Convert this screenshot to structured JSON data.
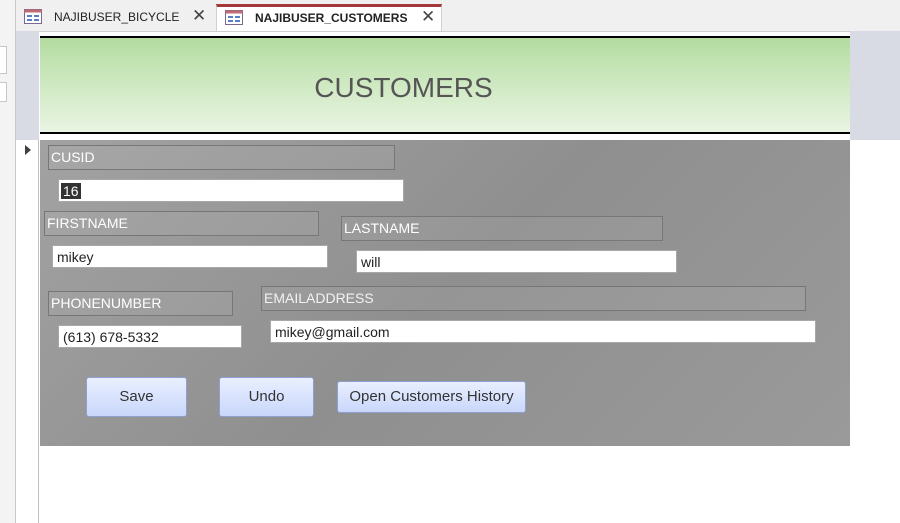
{
  "tabs": [
    {
      "label": "NAJIBUSER_BICYCLE",
      "close_glyph": "✕",
      "icon": "form-icon",
      "active": false
    },
    {
      "label": "NAJIBUSER_CUSTOMERS",
      "close_glyph": "✕",
      "icon": "form-icon",
      "active": true
    }
  ],
  "header": {
    "title": "CUSTOMERS"
  },
  "fields": {
    "cusid": {
      "label": "CUSID",
      "value": "16"
    },
    "firstname": {
      "label": "FIRSTNAME",
      "value": "mikey"
    },
    "lastname": {
      "label": "LASTNAME",
      "value": "will"
    },
    "phonenumber": {
      "label": "PHONENUMBER",
      "value": "(613) 678-5332"
    },
    "emailaddress": {
      "label": "EMAILADDRESS",
      "value": "mikey@gmail.com"
    }
  },
  "buttons": {
    "save": "Save",
    "undo": "Undo",
    "history": "Open Customers History"
  },
  "colors": {
    "active_tab_accent": "#a4373a",
    "header_gradient_top": "#b3dca0",
    "header_gradient_bottom": "#eaf5e4",
    "detail_background": "#9a9a9a",
    "button_gradient_top": "#e9efff",
    "button_gradient_bottom": "#c9d7fb"
  }
}
